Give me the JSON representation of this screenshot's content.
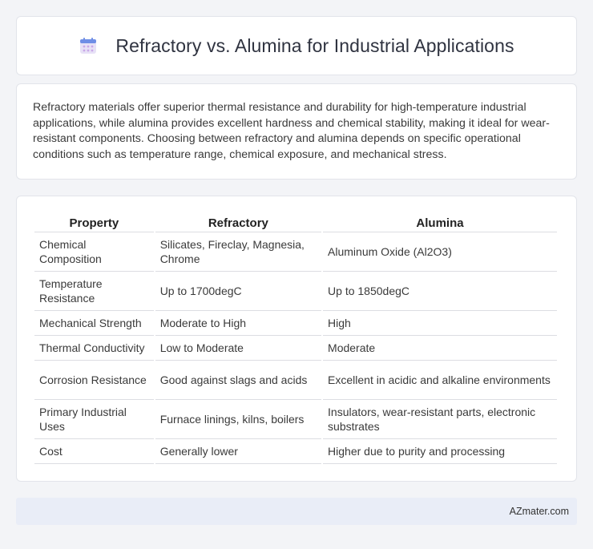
{
  "header": {
    "title": "Refractory vs. Alumina for Industrial Applications",
    "icon": "calendar-icon",
    "icon_colors": {
      "top": "#6f8ee6",
      "body": "#e7e1f6",
      "dots": "#c9a8e8"
    }
  },
  "intro": {
    "text": "Refractory materials offer superior thermal resistance and durability for high-temperature industrial applications, while alumina provides excellent hardness and chemical stability, making it ideal for wear-resistant components. Choosing between refractory and alumina depends on specific operational conditions such as temperature range, chemical exposure, and mechanical stress."
  },
  "table": {
    "headers": [
      "Property",
      "Refractory",
      "Alumina"
    ],
    "rows": [
      [
        "Chemical Composition",
        "Silicates, Fireclay, Magnesia, Chrome",
        "Aluminum Oxide (Al2O3)"
      ],
      [
        "Temperature Resistance",
        "Up to 1700degC",
        "Up to 1850degC"
      ],
      [
        "Mechanical Strength",
        "Moderate to High",
        "High"
      ],
      [
        "Thermal Conductivity",
        "Low to Moderate",
        "Moderate"
      ],
      [
        "Corrosion Resistance",
        "Good against slags and acids",
        "Excellent in acidic and alkaline environments"
      ],
      [
        "Primary Industrial Uses",
        "Furnace linings, kilns, boilers",
        "Insulators, wear-resistant parts, electronic substrates"
      ],
      [
        "Cost",
        "Generally lower",
        "Higher due to purity and processing"
      ]
    ]
  },
  "footer": {
    "text": "AZmater.com"
  }
}
